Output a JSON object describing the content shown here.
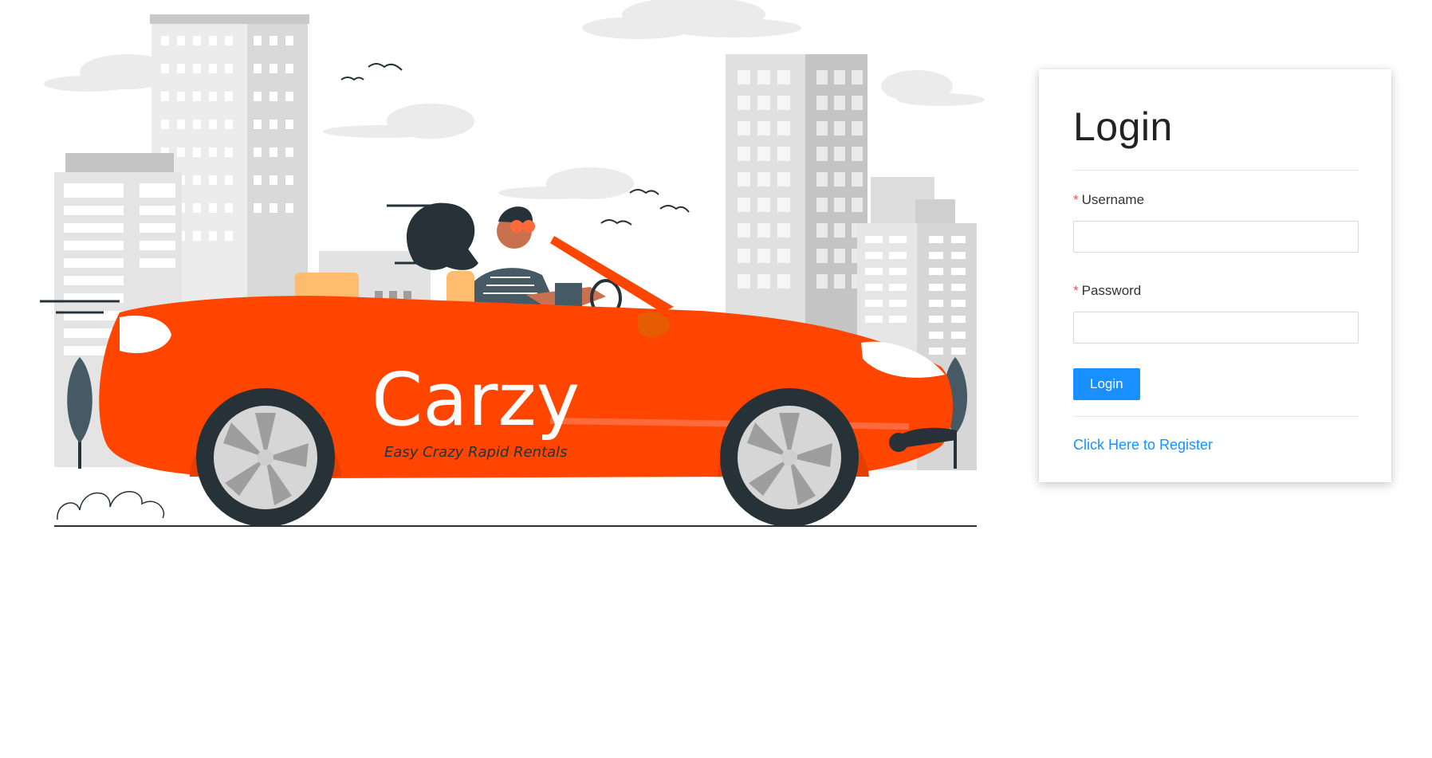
{
  "hero": {
    "brand_name": "Carzy",
    "tagline": "Easy Crazy Rapid Rentals",
    "colors": {
      "car": "#ff4500",
      "buildings": "#d6d6d6",
      "clouds": "#ebebeb",
      "dark": "#263238"
    }
  },
  "login_form": {
    "title": "Login",
    "username_label": "Username",
    "password_label": "Password",
    "required_mark": "*",
    "username_value": "",
    "password_value": "",
    "submit_label": "Login",
    "register_link": "Click Here to Register",
    "accent_color": "#1890ff"
  }
}
